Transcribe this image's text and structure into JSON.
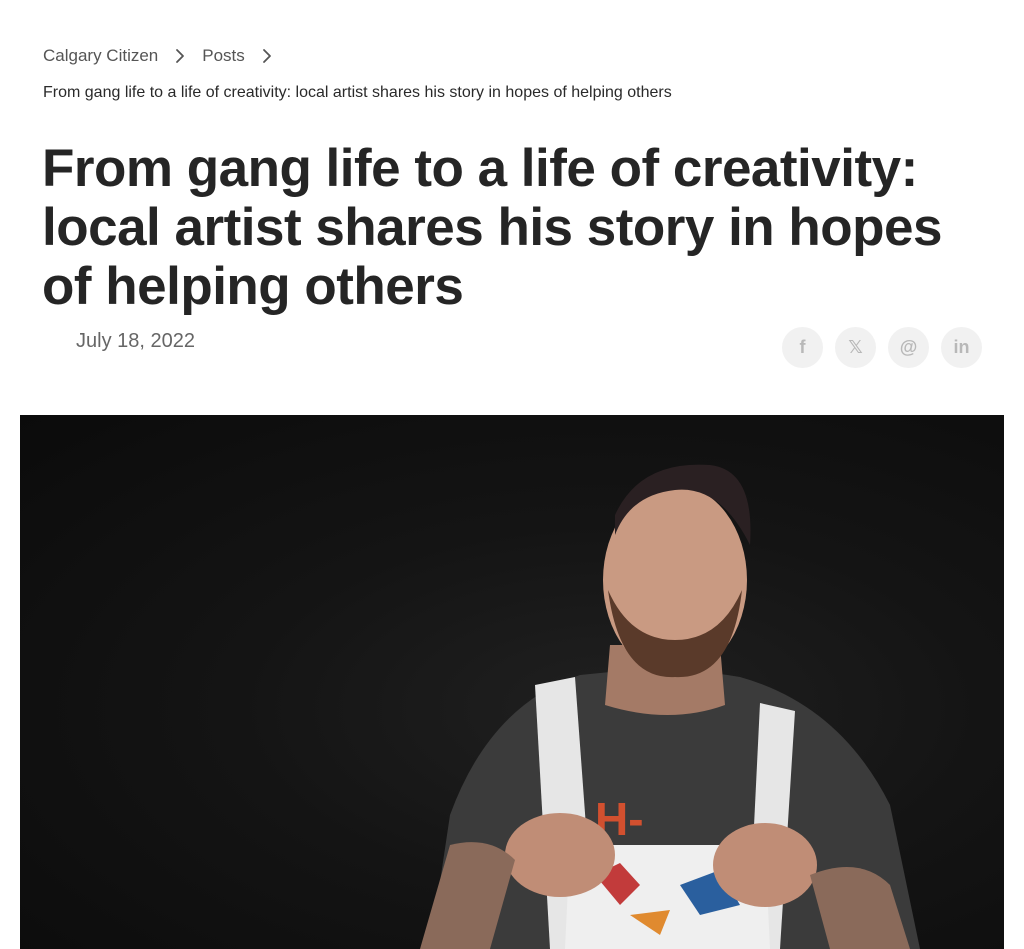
{
  "breadcrumb": {
    "items": [
      {
        "label": "Calgary Citizen"
      },
      {
        "label": "Posts"
      }
    ],
    "current": "From gang life to a life of creativity: local artist shares his story in hopes of helping others"
  },
  "article": {
    "title": "From gang life to a life of creativity: local artist shares his story in hopes of helping others",
    "date": "July 18, 2022"
  },
  "share": [
    {
      "icon": "facebook-icon",
      "glyph": "f"
    },
    {
      "icon": "x-icon",
      "glyph": "𝕏"
    },
    {
      "icon": "threads-icon",
      "glyph": "@"
    },
    {
      "icon": "linkedin-icon",
      "glyph": "in"
    }
  ],
  "colors": {
    "title": "#252525",
    "meta": "#666666",
    "share_bg": "#f1f1f1",
    "share_icon": "#b8b8b8",
    "hero_bg": "#111111"
  }
}
